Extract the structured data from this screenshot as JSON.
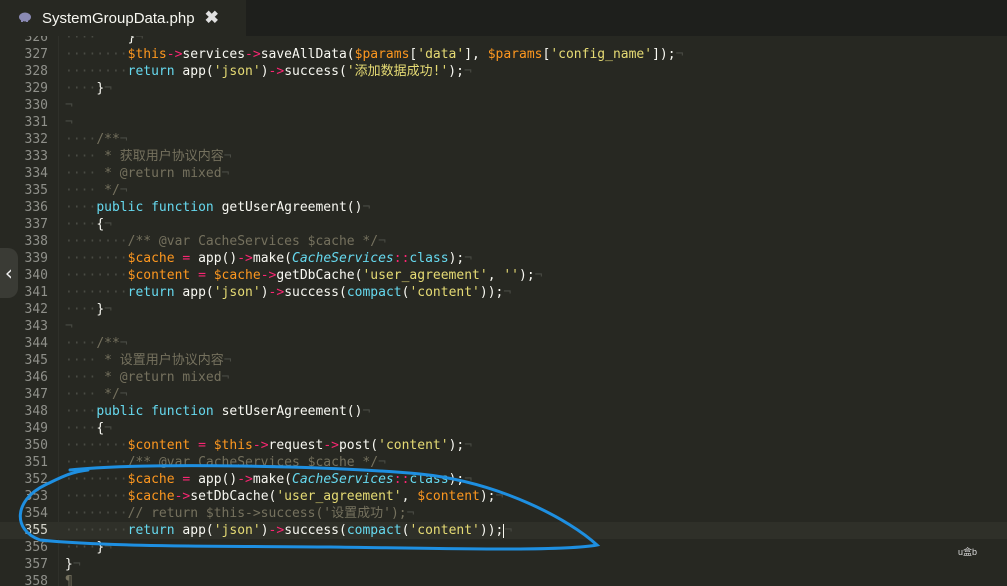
{
  "tab": {
    "title": "SystemGroupData.php",
    "close_glyph": "✖",
    "icon": "php-elephant-icon"
  },
  "editor": {
    "lines": [
      {
        "n": "326",
        "code": [
          [
            "p",
            "    }"
          ]
        ]
      },
      {
        "n": "327",
        "code": [
          [
            "v",
            "$this"
          ],
          [
            "o",
            "->"
          ],
          [
            "p",
            "services"
          ],
          [
            "o",
            "->"
          ],
          [
            "p",
            "saveAllData("
          ],
          [
            "v",
            "$params"
          ],
          [
            "p",
            "["
          ],
          [
            "s",
            "'data'"
          ],
          [
            "p",
            "], "
          ],
          [
            "v",
            "$params"
          ],
          [
            "p",
            "["
          ],
          [
            "s",
            "'config_name'"
          ],
          [
            "p",
            "]);"
          ]
        ]
      },
      {
        "n": "328",
        "code": [
          [
            "k",
            "return "
          ],
          [
            "p",
            "app("
          ],
          [
            "s",
            "'json'"
          ],
          [
            "p",
            ")"
          ],
          [
            "o",
            "->"
          ],
          [
            "p",
            "success("
          ],
          [
            "s",
            "'添加数据成功!'"
          ],
          [
            "p",
            ");"
          ]
        ]
      },
      {
        "n": "329",
        "code": [
          [
            "p",
            "}"
          ]
        ]
      },
      {
        "n": "330",
        "code": []
      },
      {
        "n": "331",
        "code": []
      },
      {
        "n": "332",
        "code": [
          [
            "c",
            "/**"
          ]
        ]
      },
      {
        "n": "333",
        "code": [
          [
            "c",
            " * 获取用户协议内容"
          ]
        ]
      },
      {
        "n": "334",
        "code": [
          [
            "c",
            " * @return mixed"
          ]
        ]
      },
      {
        "n": "335",
        "code": [
          [
            "c",
            " */"
          ]
        ]
      },
      {
        "n": "336",
        "code": [
          [
            "k",
            "public "
          ],
          [
            "k",
            "function "
          ],
          [
            "p",
            "getUserAgreement()"
          ]
        ]
      },
      {
        "n": "337",
        "code": [
          [
            "p",
            "{"
          ]
        ]
      },
      {
        "n": "338",
        "code": [
          [
            "c",
            "/** @var CacheServices $cache */"
          ]
        ]
      },
      {
        "n": "339",
        "code": [
          [
            "v",
            "$cache"
          ],
          [
            "o",
            " = "
          ],
          [
            "p",
            "app()"
          ],
          [
            "o",
            "->"
          ],
          [
            "p",
            "make("
          ],
          [
            "i",
            "CacheServices"
          ],
          [
            "o",
            "::"
          ],
          [
            "k",
            "class"
          ],
          [
            "p",
            ");"
          ]
        ]
      },
      {
        "n": "340",
        "code": [
          [
            "v",
            "$content"
          ],
          [
            "o",
            " = "
          ],
          [
            "v",
            "$cache"
          ],
          [
            "o",
            "->"
          ],
          [
            "p",
            "getDbCache("
          ],
          [
            "s",
            "'user_agreement'"
          ],
          [
            "p",
            ", "
          ],
          [
            "s",
            "''"
          ],
          [
            "p",
            ");"
          ]
        ]
      },
      {
        "n": "341",
        "code": [
          [
            "k",
            "return "
          ],
          [
            "p",
            "app("
          ],
          [
            "s",
            "'json'"
          ],
          [
            "p",
            ")"
          ],
          [
            "o",
            "->"
          ],
          [
            "p",
            "success("
          ],
          [
            "k",
            "compact"
          ],
          [
            "p",
            "("
          ],
          [
            "s",
            "'content'"
          ],
          [
            "p",
            "));"
          ]
        ]
      },
      {
        "n": "342",
        "code": [
          [
            "p",
            "}"
          ]
        ]
      },
      {
        "n": "343",
        "code": []
      },
      {
        "n": "344",
        "code": [
          [
            "c",
            "/**"
          ]
        ]
      },
      {
        "n": "345",
        "code": [
          [
            "c",
            " * 设置用户协议内容"
          ]
        ]
      },
      {
        "n": "346",
        "code": [
          [
            "c",
            " * @return mixed"
          ]
        ]
      },
      {
        "n": "347",
        "code": [
          [
            "c",
            " */"
          ]
        ]
      },
      {
        "n": "348",
        "code": [
          [
            "k",
            "public "
          ],
          [
            "k",
            "function "
          ],
          [
            "p",
            "setUserAgreement()"
          ]
        ]
      },
      {
        "n": "349",
        "code": [
          [
            "p",
            "{"
          ]
        ]
      },
      {
        "n": "350",
        "code": [
          [
            "v",
            "$content"
          ],
          [
            "o",
            " = "
          ],
          [
            "v",
            "$this"
          ],
          [
            "o",
            "->"
          ],
          [
            "p",
            "request"
          ],
          [
            "o",
            "->"
          ],
          [
            "p",
            "post("
          ],
          [
            "s",
            "'content'"
          ],
          [
            "p",
            ");"
          ]
        ]
      },
      {
        "n": "351",
        "code": [
          [
            "c",
            "/** @var CacheServices $cache */"
          ]
        ]
      },
      {
        "n": "352",
        "code": [
          [
            "v",
            "$cache"
          ],
          [
            "o",
            " = "
          ],
          [
            "p",
            "app()"
          ],
          [
            "o",
            "->"
          ],
          [
            "p",
            "make("
          ],
          [
            "i",
            "CacheServices"
          ],
          [
            "o",
            "::"
          ],
          [
            "k",
            "class"
          ],
          [
            "p",
            ");"
          ]
        ]
      },
      {
        "n": "353",
        "code": [
          [
            "v",
            "$cache"
          ],
          [
            "o",
            "->"
          ],
          [
            "p",
            "setDbCache("
          ],
          [
            "s",
            "'user_agreement'"
          ],
          [
            "p",
            ", "
          ],
          [
            "v",
            "$content"
          ],
          [
            "p",
            ");"
          ]
        ]
      },
      {
        "n": "354",
        "code": [
          [
            "c",
            "// return $this->success('设置成功');"
          ]
        ]
      },
      {
        "n": "355",
        "code": [
          [
            "k",
            "return "
          ],
          [
            "p",
            "app("
          ],
          [
            "s",
            "'json'"
          ],
          [
            "p",
            ")"
          ],
          [
            "o",
            "->"
          ],
          [
            "p",
            "success("
          ],
          [
            "k",
            "compact"
          ],
          [
            "p",
            "("
          ],
          [
            "s",
            "'content'"
          ],
          [
            "p",
            "));"
          ]
        ]
      },
      {
        "n": "356",
        "code": [
          [
            "p",
            "}"
          ]
        ]
      },
      {
        "n": "357",
        "code": [
          [
            "p",
            "}"
          ]
        ]
      },
      {
        "n": "358",
        "code": [
          [
            "c",
            "¶"
          ]
        ]
      }
    ]
  },
  "watermark": "u盒b"
}
